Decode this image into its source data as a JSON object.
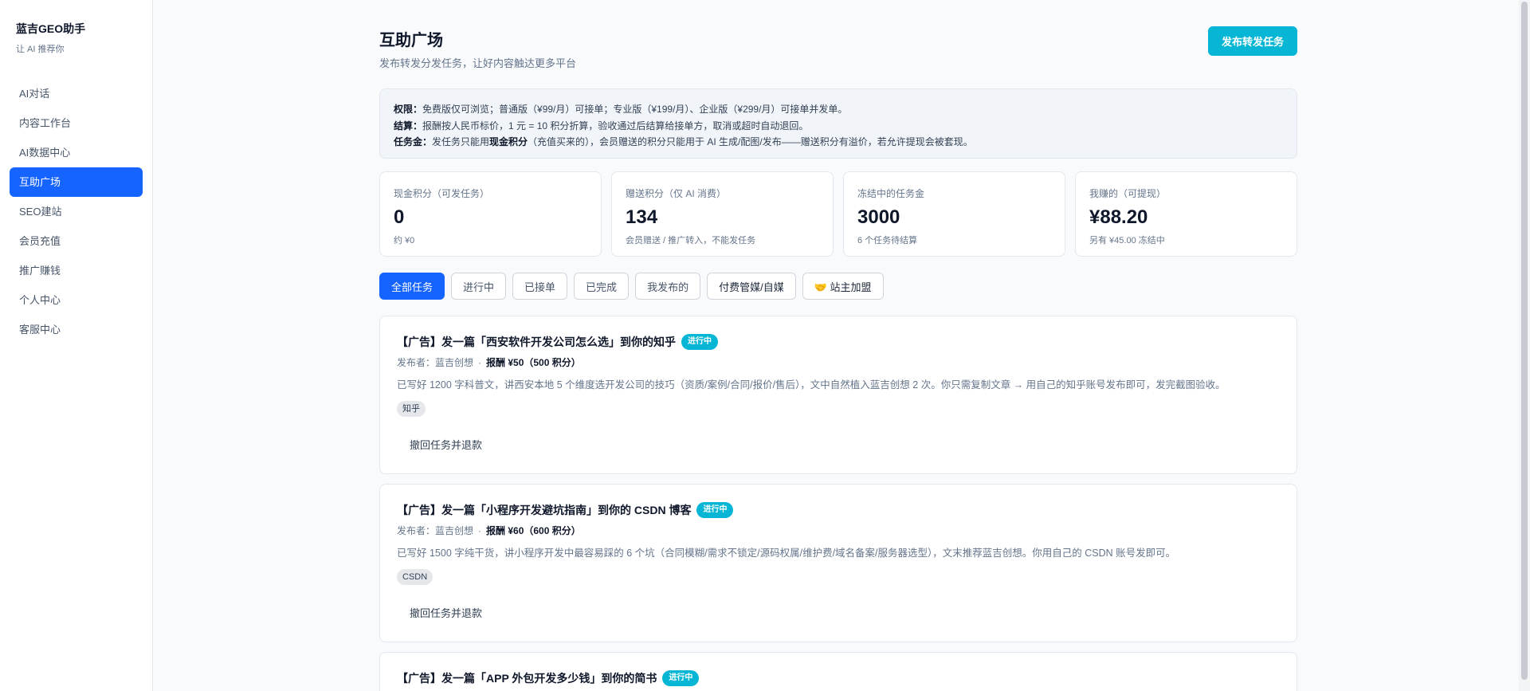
{
  "brand": {
    "name": "蓝吉GEO助手",
    "tagline": "让 AI 推荐你"
  },
  "sidebar": {
    "items": [
      {
        "label": "AI对话"
      },
      {
        "label": "内容工作台"
      },
      {
        "label": "AI数据中心"
      },
      {
        "label": "互助广场",
        "active": true
      },
      {
        "label": "SEO建站"
      },
      {
        "label": "会员充值"
      },
      {
        "label": "推广赚钱"
      },
      {
        "label": "个人中心"
      },
      {
        "label": "客服中心"
      }
    ]
  },
  "header": {
    "title": "互助广场",
    "subtitle": "发布转发分发任务，让好内容触达更多平台",
    "publish_label": "发布转发任务"
  },
  "notice": {
    "permission_label": "权限：",
    "permission_text": "免费版仅可浏览；普通版（¥99/月）可接单；专业版（¥199/月）、企业版（¥299/月）可接单并发单。",
    "settlement_label": "结算：",
    "settlement_text": "报酬按人民币标价，1 元 = 10 积分折算，验收通过后结算给接单方，取消或超时自动退回。",
    "funds_label": "任务金：",
    "funds_text_1": "发任务只能用",
    "funds_bold": "现金积分",
    "funds_text_2": "（充值买来的），会员赠送的积分只能用于 AI 生成/配图/发布——赠送积分有溢价，若允许提现会被套现。"
  },
  "stats": [
    {
      "label": "现金积分（可发任务）",
      "value": "0",
      "note": "约 ¥0"
    },
    {
      "label": "赠送积分（仅 AI 消费）",
      "value": "134",
      "note": "会员赠送 / 推广转入，不能发任务"
    },
    {
      "label": "冻结中的任务金",
      "value": "3000",
      "note": "6 个任务待结算"
    },
    {
      "label": "我赚的（可提现）",
      "value": "¥88.20",
      "note": "另有 ¥45.00 冻结中"
    }
  ],
  "filters": [
    {
      "label": "全部任务",
      "active": true
    },
    {
      "label": "进行中"
    },
    {
      "label": "已接单"
    },
    {
      "label": "已完成"
    },
    {
      "label": "我发布的"
    },
    {
      "label": "付费管媒/自媒"
    },
    {
      "label": "🤝 站主加盟"
    }
  ],
  "tasks": [
    {
      "title": "【广告】发一篇「西安软件开发公司怎么选」到你的知乎",
      "status": "进行中",
      "publisher": "发布者：蓝吉创想",
      "dot": "·",
      "reward": "报酬 ¥50（500 积分）",
      "description": "已写好 1200 字科普文，讲西安本地 5 个维度选开发公司的技巧（资质/案例/合同/报价/售后），文中自然植入蓝吉创想 2 次。你只需复制文章 → 用自己的知乎账号发布即可，发完截图验收。",
      "tag": "知乎",
      "action": "撤回任务并退款"
    },
    {
      "title": "【广告】发一篇「小程序开发避坑指南」到你的 CSDN 博客",
      "status": "进行中",
      "publisher": "发布者：蓝吉创想",
      "dot": "·",
      "reward": "报酬 ¥60（600 积分）",
      "description": "已写好 1500 字纯干货，讲小程序开发中最容易踩的 6 个坑（合同模糊/需求不锁定/源码权属/维护费/域名备案/服务器选型），文末推荐蓝吉创想。你用自己的 CSDN 账号发即可。",
      "tag": "CSDN",
      "action": "撤回任务并退款"
    },
    {
      "title": "【广告】发一篇「APP 外包开发多少钱」到你的简书",
      "status": "进行中"
    }
  ]
}
